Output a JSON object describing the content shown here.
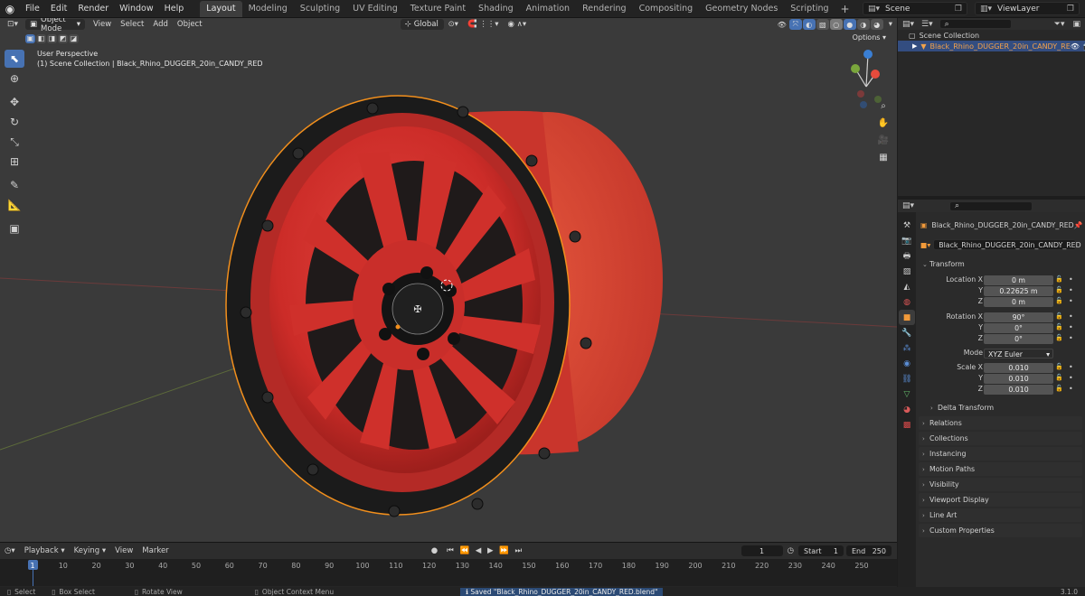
{
  "topbar": {
    "menus": [
      "File",
      "Edit",
      "Render",
      "Window",
      "Help"
    ],
    "workspaces": [
      "Layout",
      "Modeling",
      "Sculpting",
      "UV Editing",
      "Texture Paint",
      "Shading",
      "Animation",
      "Rendering",
      "Compositing",
      "Geometry Nodes",
      "Scripting"
    ],
    "active_workspace": "Layout",
    "scene": "Scene",
    "view_layer": "ViewLayer"
  },
  "viewport": {
    "mode": "Object Mode",
    "menus": [
      "View",
      "Select",
      "Add",
      "Object"
    ],
    "transform_orientation": "Global",
    "options_label": "Options",
    "info_line1": "User Perspective",
    "info_line2": "(1) Scene Collection | Black_Rhino_DUGGER_20in_CANDY_RED",
    "wheel_colors": {
      "rim": "#d5312c",
      "rim_dark": "#8f1c1a",
      "beadlock": "#1b1b1b",
      "outline": "#f28f1c"
    }
  },
  "outliner": {
    "root": "Scene Collection",
    "object": "Black_Rhino_DUGGER_20in_CANDY_RE"
  },
  "properties": {
    "object_name": "Black_Rhino_DUGGER_20in_CANDY_RED",
    "datablock_name": "Black_Rhino_DUGGER_20in_CANDY_RED",
    "transform_title": "Transform",
    "location": {
      "label_x": "Location X",
      "x": "0 m",
      "y": "0.22625 m",
      "z": "0 m"
    },
    "rotation": {
      "label_x": "Rotation X",
      "x": "90°",
      "y": "0°",
      "z": "0°"
    },
    "mode": {
      "label": "Mode",
      "value": "XYZ Euler"
    },
    "scale": {
      "label_x": "Scale X",
      "x": "0.010",
      "y": "0.010",
      "z": "0.010"
    },
    "axis_y": "Y",
    "axis_z": "Z",
    "delta_transform": "Delta Transform",
    "panels": [
      "Relations",
      "Collections",
      "Instancing",
      "Motion Paths",
      "Visibility",
      "Viewport Display",
      "Line Art",
      "Custom Properties"
    ]
  },
  "timeline": {
    "menus": [
      "Playback",
      "Keying",
      "View",
      "Marker"
    ],
    "current_frame": "1",
    "start_label": "Start",
    "start": "1",
    "end_label": "End",
    "end": "250",
    "ticks": [
      "1",
      "10",
      "20",
      "30",
      "40",
      "50",
      "60",
      "70",
      "80",
      "90",
      "100",
      "110",
      "120",
      "130",
      "140",
      "150",
      "160",
      "170",
      "180",
      "190",
      "200",
      "210",
      "220",
      "230",
      "240",
      "250"
    ]
  },
  "statusbar": {
    "select": "Select",
    "box_select": "Box Select",
    "rotate_view": "Rotate View",
    "context_menu": "Object Context Menu",
    "message": "Saved \"Black_Rhino_DUGGER_20in_CANDY_RED.blend\"",
    "version": "3.1.0"
  }
}
